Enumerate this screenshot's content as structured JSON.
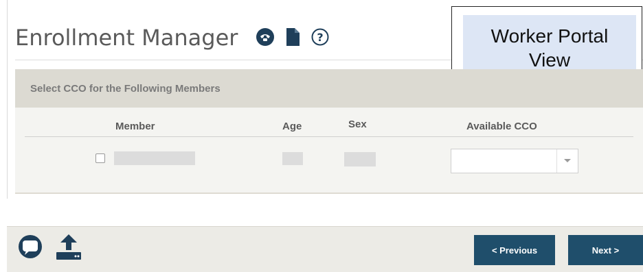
{
  "header": {
    "title": "Enrollment Manager",
    "icons": [
      "phone-icon",
      "document-icon",
      "help-icon"
    ]
  },
  "badge": {
    "line1": "Worker Portal",
    "line2": "View"
  },
  "panel": {
    "heading": "Select CCO for the Following Members",
    "columns": {
      "member": "Member",
      "age": "Age",
      "sex": "Sex",
      "available_cco": "Available CCO"
    },
    "row": {
      "checked": false,
      "member": "",
      "age": "",
      "sex": "",
      "cco_selected": ""
    }
  },
  "footer": {
    "icons": [
      "chat-icon",
      "upload-icon"
    ],
    "previous_label": "< Previous",
    "next_label": "Next >"
  },
  "colors": {
    "primary_button": "#1f4e6b",
    "panel_header": "#dcdad2",
    "badge_fill": "#dde6f5"
  }
}
